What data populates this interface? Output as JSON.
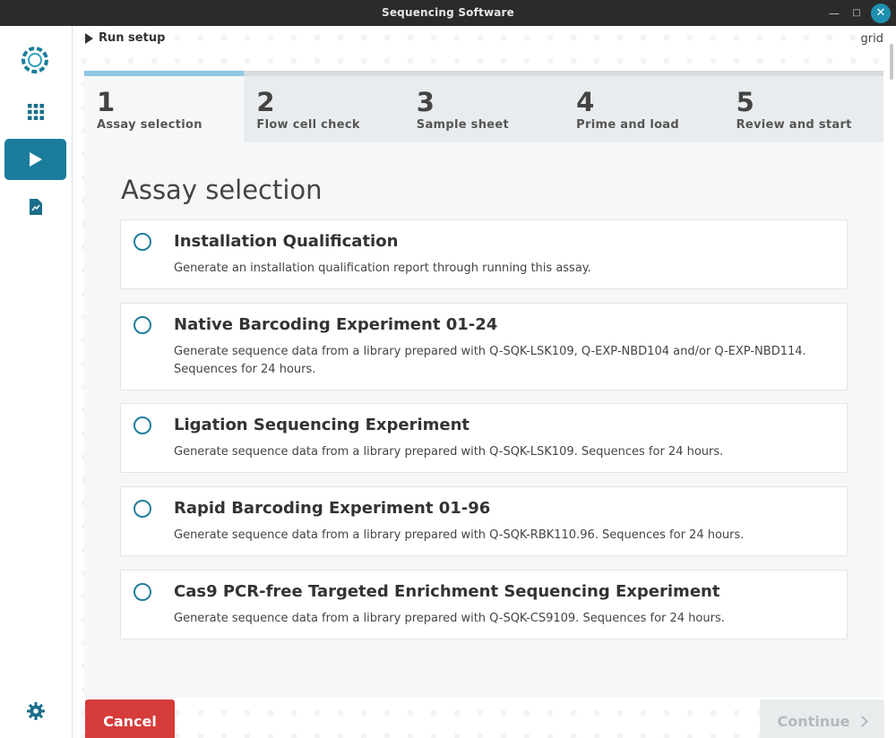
{
  "window": {
    "title": "Sequencing Software",
    "close_icon": "close-icon"
  },
  "sidebar": {
    "items": [
      {
        "name": "apps-grid-icon",
        "active": false
      },
      {
        "name": "play-icon",
        "active": true
      },
      {
        "name": "report-icon",
        "active": false
      }
    ],
    "settings_icon": "gear-icon"
  },
  "header": {
    "section": "Run setup",
    "device": "grid"
  },
  "steps": [
    {
      "num": "1",
      "label": "Assay selection",
      "active": true
    },
    {
      "num": "2",
      "label": "Flow cell check",
      "active": false
    },
    {
      "num": "3",
      "label": "Sample sheet",
      "active": false
    },
    {
      "num": "4",
      "label": "Prime and load",
      "active": false
    },
    {
      "num": "5",
      "label": "Review and start",
      "active": false
    }
  ],
  "heading": "Assay selection",
  "options": [
    {
      "title": "Installation Qualification",
      "desc": "Generate an installation qualification report through running this assay."
    },
    {
      "title": "Native Barcoding Experiment 01-24",
      "desc": "Generate sequence data from a library prepared with Q-SQK-LSK109, Q-EXP-NBD104 and/or Q-EXP-NBD114. Sequences for 24 hours."
    },
    {
      "title": "Ligation Sequencing Experiment",
      "desc": "Generate sequence data from a library prepared with Q-SQK-LSK109. Sequences for 24 hours."
    },
    {
      "title": "Rapid Barcoding Experiment 01-96",
      "desc": "Generate sequence data from a library prepared with Q-SQK-RBK110.96. Sequences for 24 hours."
    },
    {
      "title": "Cas9 PCR-free Targeted Enrichment Sequencing Experiment",
      "desc": "Generate sequence data from a library prepared with Q-SQK-CS9109. Sequences for 24 hours."
    }
  ],
  "buttons": {
    "cancel": "Cancel",
    "continue": "Continue"
  },
  "colors": {
    "accent": "#1a7d9c",
    "cancel": "#d63c3a",
    "step_active": "#8ec8e4"
  }
}
